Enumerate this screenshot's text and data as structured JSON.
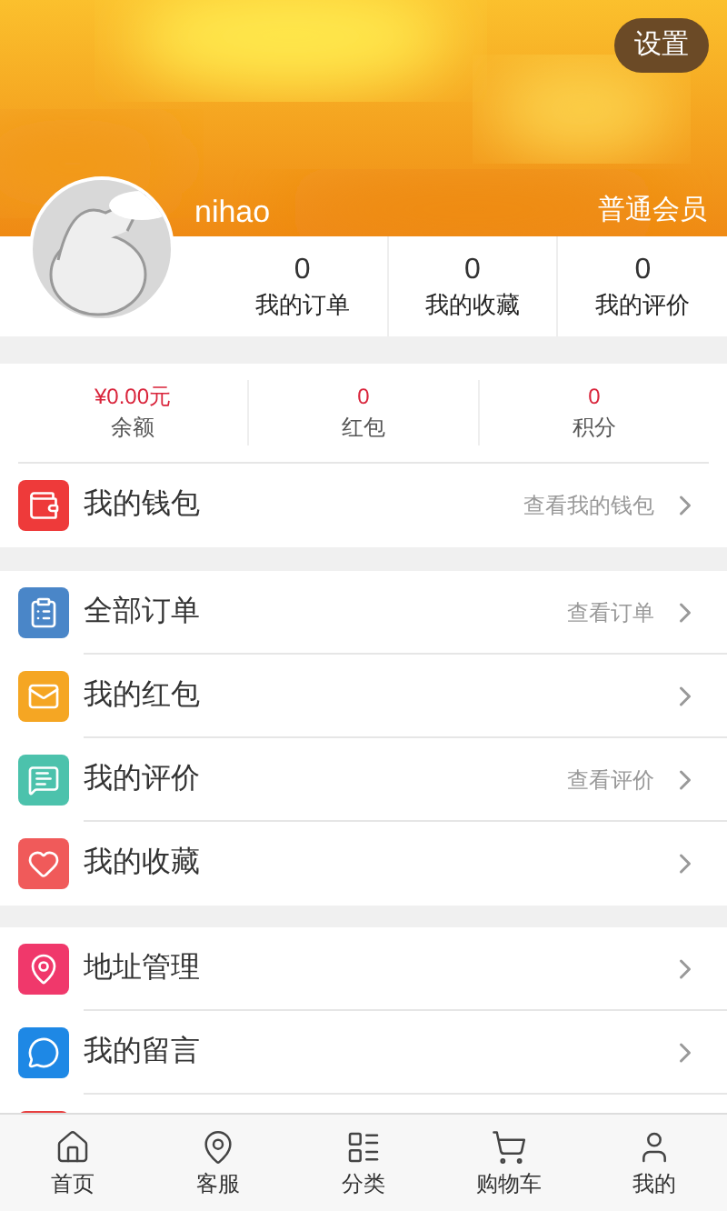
{
  "header": {
    "settings_button": "设置",
    "username": "nihao",
    "member_level": "普通会员"
  },
  "stats": [
    {
      "value": "0",
      "label": "我的订单"
    },
    {
      "value": "0",
      "label": "我的收藏"
    },
    {
      "value": "0",
      "label": "我的评价"
    }
  ],
  "assets": [
    {
      "value": "¥0.00元",
      "label": "余额"
    },
    {
      "value": "0",
      "label": "红包"
    },
    {
      "value": "0",
      "label": "积分"
    }
  ],
  "wallet": {
    "label": "我的钱包",
    "hint": "查看我的钱包",
    "color": "#ee3a3a"
  },
  "sections": [
    [
      {
        "label": "全部订单",
        "hint": "查看订单",
        "color": "#4a86c8"
      },
      {
        "label": "我的红包",
        "color": "#f5a623"
      },
      {
        "label": "我的评价",
        "hint": "查看评价",
        "color": "#4cc2ac"
      },
      {
        "label": "我的收藏",
        "color": "#f05a5a"
      }
    ],
    [
      {
        "label": "地址管理",
        "color": "#f0386b"
      },
      {
        "label": "我的留言",
        "color": "#1e88e5"
      },
      {
        "color": "#e84040"
      }
    ]
  ],
  "tabs": [
    {
      "label": "首页"
    },
    {
      "label": "客服"
    },
    {
      "label": "分类"
    },
    {
      "label": "购物车"
    },
    {
      "label": "我的"
    }
  ]
}
